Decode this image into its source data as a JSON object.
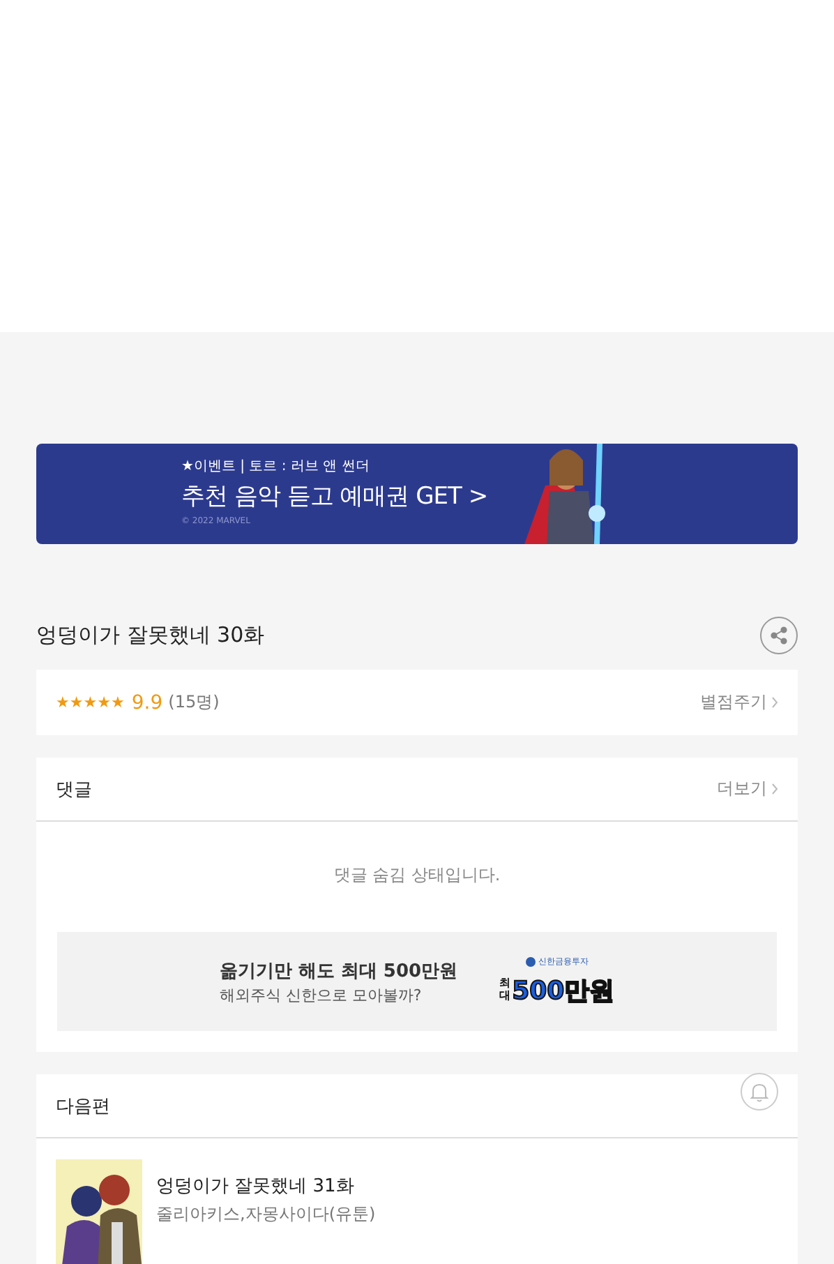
{
  "banner": {
    "kind": "picture",
    "eyebrow": "★이벤트 | 토르 : 러브 앤 썬더",
    "headline": "추천 음악 듣고 예매권 GET >",
    "copyright": "© 2022 MARVEL"
  },
  "episode": {
    "title": "엉덩이가 잘못했네 30화"
  },
  "rating": {
    "stars": 5,
    "score": "9.9",
    "count": "(15명)",
    "action": "별점주기"
  },
  "comments": {
    "title": "댓글",
    "more": "더보기",
    "notice": "댓글 숨김 상태입니다."
  },
  "ad": {
    "headline": "옮기기만 해도 최대 500만원",
    "subline": "해외주식 신한으로 모아볼까?",
    "brand": "신한금융투자",
    "badge_prefix": "최대",
    "badge_amount": "500만원"
  },
  "next": {
    "title": "다음편",
    "alarm_on": false,
    "items": [
      {
        "title": "엉덩이가 잘못했네 31화",
        "authors": "줄리아키스,자몽사이다(유툰)"
      }
    ]
  }
}
